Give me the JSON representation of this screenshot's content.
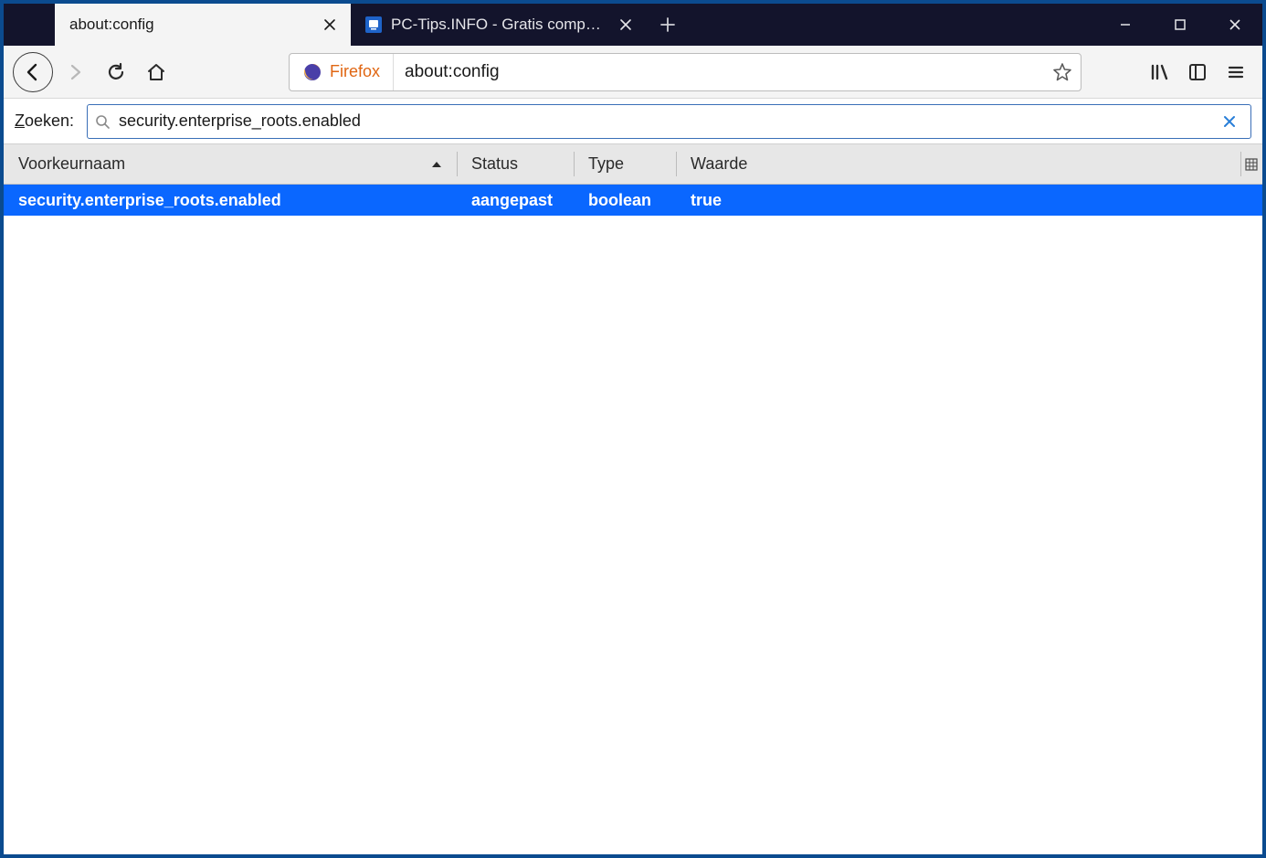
{
  "tabs": {
    "active": {
      "title": "about:config"
    },
    "inactive": {
      "title": "PC-Tips.INFO - Gratis computer"
    }
  },
  "urlbar": {
    "brand": "Firefox",
    "url": "about:config"
  },
  "search": {
    "label_prefix": "Z",
    "label_rest": "oeken:",
    "value": "security.enterprise_roots.enabled"
  },
  "columns": {
    "name": "Voorkeurnaam",
    "status": "Status",
    "type": "Type",
    "value": "Waarde"
  },
  "rows": [
    {
      "name": "security.enterprise_roots.enabled",
      "status": "aangepast",
      "type": "boolean",
      "value": "true"
    }
  ]
}
